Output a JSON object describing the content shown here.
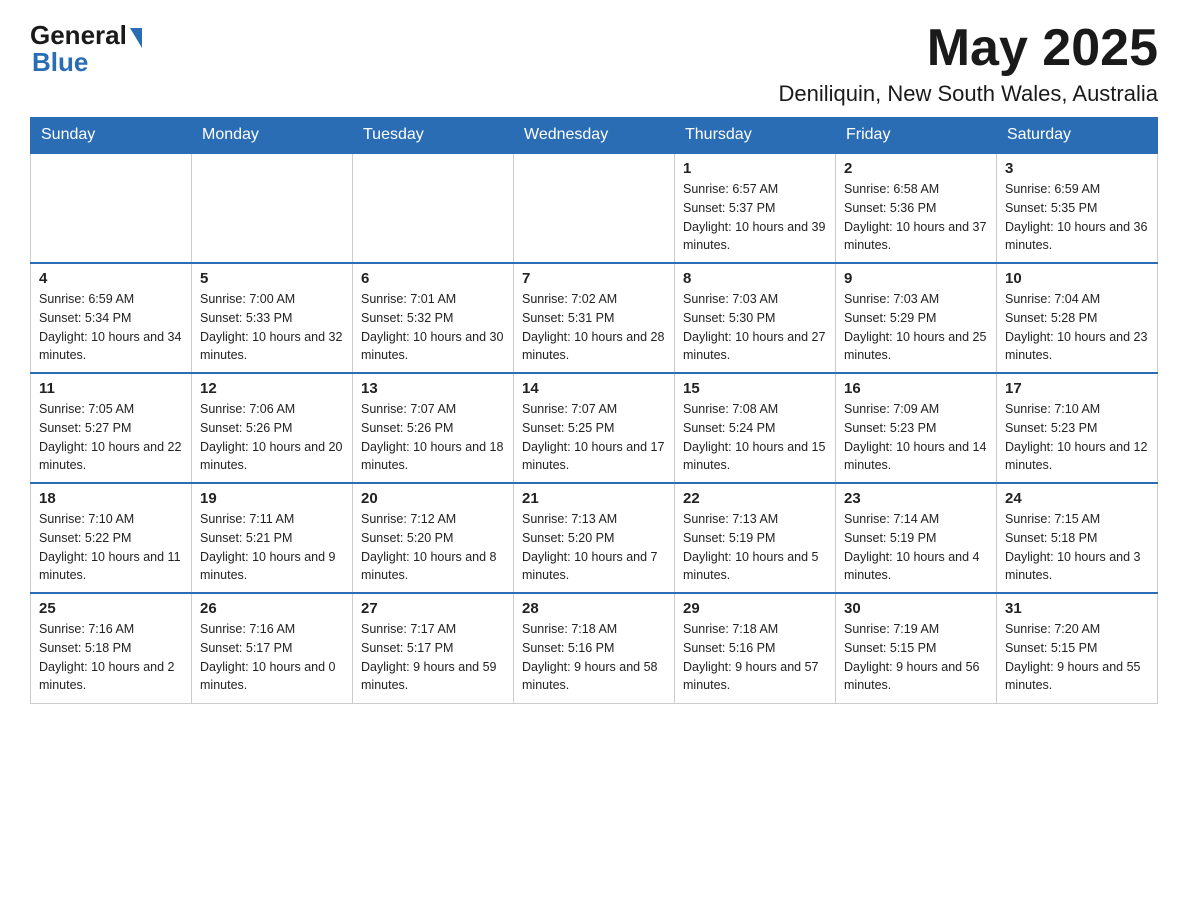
{
  "header": {
    "logo_general": "General",
    "logo_blue": "Blue",
    "month_year": "May 2025",
    "location": "Deniliquin, New South Wales, Australia"
  },
  "days_of_week": [
    "Sunday",
    "Monday",
    "Tuesday",
    "Wednesday",
    "Thursday",
    "Friday",
    "Saturday"
  ],
  "weeks": [
    [
      {
        "day": "",
        "info": ""
      },
      {
        "day": "",
        "info": ""
      },
      {
        "day": "",
        "info": ""
      },
      {
        "day": "",
        "info": ""
      },
      {
        "day": "1",
        "info": "Sunrise: 6:57 AM\nSunset: 5:37 PM\nDaylight: 10 hours and 39 minutes."
      },
      {
        "day": "2",
        "info": "Sunrise: 6:58 AM\nSunset: 5:36 PM\nDaylight: 10 hours and 37 minutes."
      },
      {
        "day": "3",
        "info": "Sunrise: 6:59 AM\nSunset: 5:35 PM\nDaylight: 10 hours and 36 minutes."
      }
    ],
    [
      {
        "day": "4",
        "info": "Sunrise: 6:59 AM\nSunset: 5:34 PM\nDaylight: 10 hours and 34 minutes."
      },
      {
        "day": "5",
        "info": "Sunrise: 7:00 AM\nSunset: 5:33 PM\nDaylight: 10 hours and 32 minutes."
      },
      {
        "day": "6",
        "info": "Sunrise: 7:01 AM\nSunset: 5:32 PM\nDaylight: 10 hours and 30 minutes."
      },
      {
        "day": "7",
        "info": "Sunrise: 7:02 AM\nSunset: 5:31 PM\nDaylight: 10 hours and 28 minutes."
      },
      {
        "day": "8",
        "info": "Sunrise: 7:03 AM\nSunset: 5:30 PM\nDaylight: 10 hours and 27 minutes."
      },
      {
        "day": "9",
        "info": "Sunrise: 7:03 AM\nSunset: 5:29 PM\nDaylight: 10 hours and 25 minutes."
      },
      {
        "day": "10",
        "info": "Sunrise: 7:04 AM\nSunset: 5:28 PM\nDaylight: 10 hours and 23 minutes."
      }
    ],
    [
      {
        "day": "11",
        "info": "Sunrise: 7:05 AM\nSunset: 5:27 PM\nDaylight: 10 hours and 22 minutes."
      },
      {
        "day": "12",
        "info": "Sunrise: 7:06 AM\nSunset: 5:26 PM\nDaylight: 10 hours and 20 minutes."
      },
      {
        "day": "13",
        "info": "Sunrise: 7:07 AM\nSunset: 5:26 PM\nDaylight: 10 hours and 18 minutes."
      },
      {
        "day": "14",
        "info": "Sunrise: 7:07 AM\nSunset: 5:25 PM\nDaylight: 10 hours and 17 minutes."
      },
      {
        "day": "15",
        "info": "Sunrise: 7:08 AM\nSunset: 5:24 PM\nDaylight: 10 hours and 15 minutes."
      },
      {
        "day": "16",
        "info": "Sunrise: 7:09 AM\nSunset: 5:23 PM\nDaylight: 10 hours and 14 minutes."
      },
      {
        "day": "17",
        "info": "Sunrise: 7:10 AM\nSunset: 5:23 PM\nDaylight: 10 hours and 12 minutes."
      }
    ],
    [
      {
        "day": "18",
        "info": "Sunrise: 7:10 AM\nSunset: 5:22 PM\nDaylight: 10 hours and 11 minutes."
      },
      {
        "day": "19",
        "info": "Sunrise: 7:11 AM\nSunset: 5:21 PM\nDaylight: 10 hours and 9 minutes."
      },
      {
        "day": "20",
        "info": "Sunrise: 7:12 AM\nSunset: 5:20 PM\nDaylight: 10 hours and 8 minutes."
      },
      {
        "day": "21",
        "info": "Sunrise: 7:13 AM\nSunset: 5:20 PM\nDaylight: 10 hours and 7 minutes."
      },
      {
        "day": "22",
        "info": "Sunrise: 7:13 AM\nSunset: 5:19 PM\nDaylight: 10 hours and 5 minutes."
      },
      {
        "day": "23",
        "info": "Sunrise: 7:14 AM\nSunset: 5:19 PM\nDaylight: 10 hours and 4 minutes."
      },
      {
        "day": "24",
        "info": "Sunrise: 7:15 AM\nSunset: 5:18 PM\nDaylight: 10 hours and 3 minutes."
      }
    ],
    [
      {
        "day": "25",
        "info": "Sunrise: 7:16 AM\nSunset: 5:18 PM\nDaylight: 10 hours and 2 minutes."
      },
      {
        "day": "26",
        "info": "Sunrise: 7:16 AM\nSunset: 5:17 PM\nDaylight: 10 hours and 0 minutes."
      },
      {
        "day": "27",
        "info": "Sunrise: 7:17 AM\nSunset: 5:17 PM\nDaylight: 9 hours and 59 minutes."
      },
      {
        "day": "28",
        "info": "Sunrise: 7:18 AM\nSunset: 5:16 PM\nDaylight: 9 hours and 58 minutes."
      },
      {
        "day": "29",
        "info": "Sunrise: 7:18 AM\nSunset: 5:16 PM\nDaylight: 9 hours and 57 minutes."
      },
      {
        "day": "30",
        "info": "Sunrise: 7:19 AM\nSunset: 5:15 PM\nDaylight: 9 hours and 56 minutes."
      },
      {
        "day": "31",
        "info": "Sunrise: 7:20 AM\nSunset: 5:15 PM\nDaylight: 9 hours and 55 minutes."
      }
    ]
  ]
}
